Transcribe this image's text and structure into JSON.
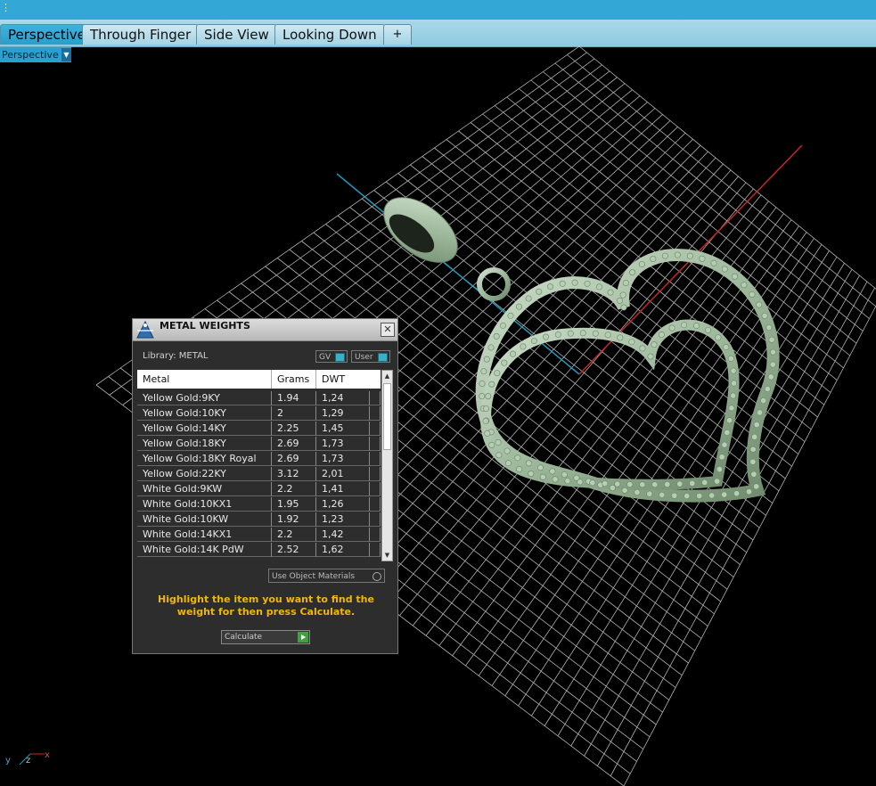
{
  "titlebar": {
    "glyph": "⋮"
  },
  "tabs": [
    {
      "label": "Perspective",
      "active": true
    },
    {
      "label": "Through Finger"
    },
    {
      "label": "Side View"
    },
    {
      "label": "Looking Down"
    },
    {
      "label": "+"
    }
  ],
  "viewport": {
    "view_label": "Perspective",
    "dropdown_arrow": "▼",
    "axes": [
      "y",
      "z",
      "x"
    ]
  },
  "panel": {
    "title": "METAL WEIGHTS",
    "close_glyph": "✕",
    "library_label": "Library: METAL",
    "toggle_gv": "GV",
    "toggle_user": "User",
    "columns": [
      "Metal",
      "Grams",
      "DWT"
    ],
    "rows": [
      {
        "metal": "Yellow Gold:9KY",
        "grams": "1.94",
        "dwt": "1,24"
      },
      {
        "metal": "Yellow Gold:10KY",
        "grams": "2",
        "dwt": "1,29"
      },
      {
        "metal": "Yellow Gold:14KY",
        "grams": "2.25",
        "dwt": "1,45"
      },
      {
        "metal": "Yellow Gold:18KY",
        "grams": "2.69",
        "dwt": "1,73"
      },
      {
        "metal": "Yellow Gold:18KY Royal",
        "grams": "2.69",
        "dwt": "1,73"
      },
      {
        "metal": "Yellow Gold:22KY",
        "grams": "3.12",
        "dwt": "2,01"
      },
      {
        "metal": "White Gold:9KW",
        "grams": "2.2",
        "dwt": "1,41"
      },
      {
        "metal": "White Gold:10KX1",
        "grams": "1.95",
        "dwt": "1,26"
      },
      {
        "metal": "White Gold:10KW",
        "grams": "1.92",
        "dwt": "1,23"
      },
      {
        "metal": "White Gold:14KX1",
        "grams": "2.2",
        "dwt": "1,42"
      },
      {
        "metal": "White Gold:14K PdW",
        "grams": "2.52",
        "dwt": "1,62"
      }
    ],
    "scroll_up": "▲",
    "scroll_down": "▼",
    "use_object_materials": "Use Object Materials",
    "hint": "Highlight the item you want to find the weight for then press Calculate.",
    "calculate_label": "Calculate"
  },
  "colors": {
    "accent": "#33a8d6",
    "hint": "#f2b705",
    "model": "#a8c2a6",
    "grid": "#d0d0d0",
    "axis_x": "#c62828",
    "axis_y": "#1d9bc0"
  }
}
